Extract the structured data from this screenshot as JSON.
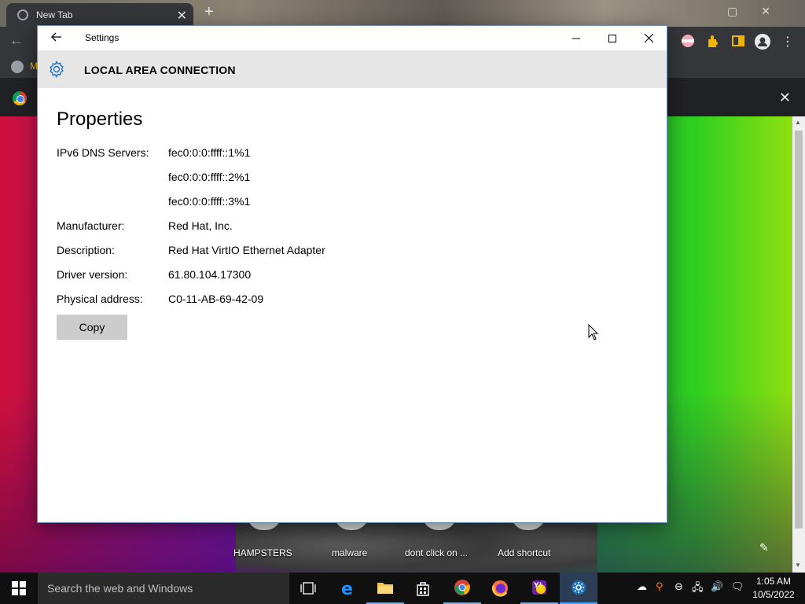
{
  "browser": {
    "tab_title": "New Tab",
    "bookmark_label": "M",
    "new_tab_symbol": "+",
    "close_symbol": "✕"
  },
  "shortcuts": [
    {
      "label": "HAMPSTERS"
    },
    {
      "label": "malware"
    },
    {
      "label": "dont click on ..."
    },
    {
      "label": "Add shortcut"
    }
  ],
  "settings_window": {
    "title": "Settings",
    "header_title": "LOCAL AREA CONNECTION",
    "section_title": "Properties",
    "properties": [
      {
        "label": "IPv6 DNS Servers:",
        "value": "fec0:0:0:ffff::1%1"
      },
      {
        "label": "",
        "value": "fec0:0:0:ffff::2%1"
      },
      {
        "label": "",
        "value": "fec0:0:0:ffff::3%1"
      },
      {
        "label": "Manufacturer:",
        "value": "Red Hat, Inc."
      },
      {
        "label": "Description:",
        "value": "Red Hat VirtIO Ethernet Adapter"
      },
      {
        "label": "Driver version:",
        "value": "61.80.104.17300"
      },
      {
        "label": "Physical address:",
        "value": "C0-11-AB-69-42-09"
      }
    ],
    "copy_label": "Copy"
  },
  "taskbar": {
    "search_placeholder": "Search the web and Windows",
    "time": "1:05 AM",
    "date": "10/5/2022",
    "apps": [
      "task-view-icon",
      "edge-icon",
      "file-explorer-icon",
      "store-icon",
      "chrome-icon",
      "firefox-icon",
      "yahoo-messenger-icon",
      "settings-icon"
    ]
  },
  "colors": {
    "accent": "#1e73be",
    "window_header": "#e6e6e6",
    "copy_button": "#cccccc",
    "taskbar": "#101010"
  }
}
